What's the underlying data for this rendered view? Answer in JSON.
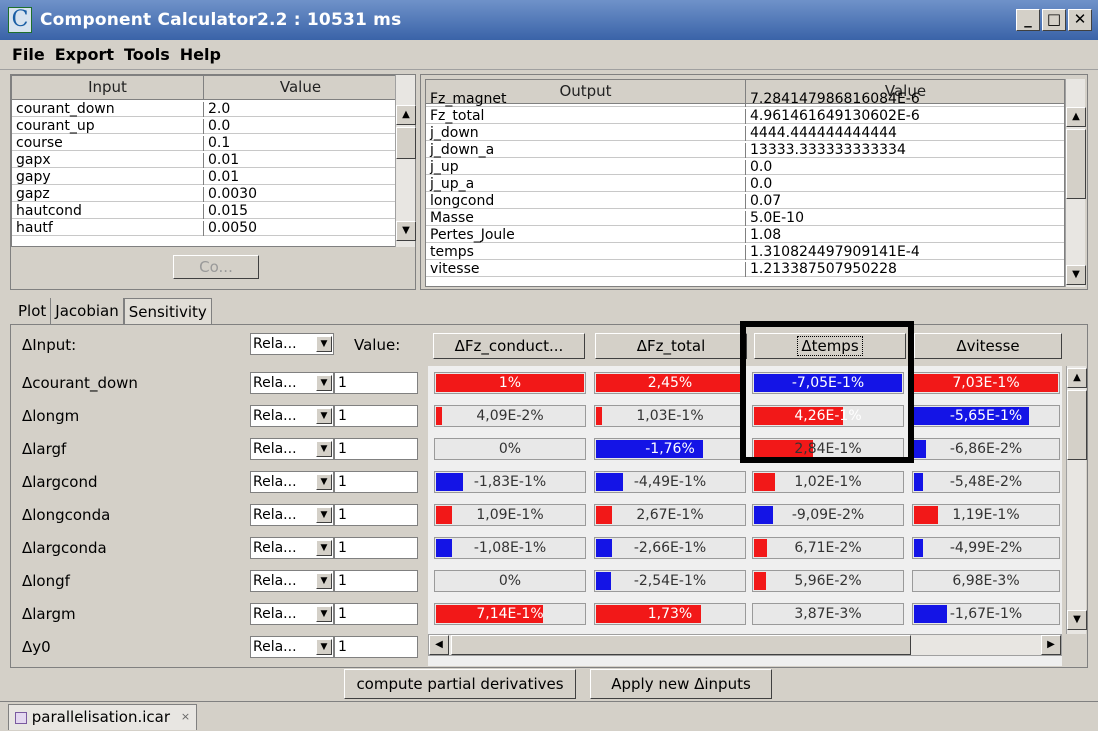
{
  "window": {
    "title": "Component Calculator2.2 : 10531 ms"
  },
  "menu": [
    "File",
    "Export",
    "Tools",
    "Help"
  ],
  "input_table": {
    "headers": [
      "Input",
      "Value"
    ],
    "rows": [
      [
        "courant_down",
        "2.0"
      ],
      [
        "courant_up",
        "0.0"
      ],
      [
        "course",
        "0.1"
      ],
      [
        "gapx",
        "0.01"
      ],
      [
        "gapy",
        "0.01"
      ],
      [
        "gapz",
        "0.0030"
      ],
      [
        "hautcond",
        "0.015"
      ],
      [
        "hautf",
        "0.0050"
      ]
    ],
    "button": "Co..."
  },
  "output_table": {
    "headers": [
      "Output",
      "Value"
    ],
    "rows": [
      [
        "Fz_magnet",
        "7.284147986816084E-6"
      ],
      [
        "Fz_total",
        "4.961461649130602E-6"
      ],
      [
        "j_down",
        "4444.444444444444"
      ],
      [
        "j_down_a",
        "13333.333333333334"
      ],
      [
        "j_up",
        "0.0"
      ],
      [
        "j_up_a",
        "0.0"
      ],
      [
        "longcond",
        "0.07"
      ],
      [
        "Masse",
        "5.0E-10"
      ],
      [
        "Pertes_Joule",
        "1.08"
      ],
      [
        "temps",
        "1.310824497909141E-4"
      ],
      [
        "vitesse",
        "1.213387507950228"
      ]
    ]
  },
  "tabs": [
    "Plot",
    "Jacobian",
    "Sensitivity"
  ],
  "sensitivity": {
    "input_label": "ΔInput:",
    "header_combo": "Rela...",
    "value_label": "Value:",
    "columns": [
      "ΔFz_conduct...",
      "ΔFz_total",
      "Δtemps",
      "Δvitesse"
    ],
    "rows": [
      {
        "name": "Δcourant_down",
        "mode": "Rela...",
        "value": "1"
      },
      {
        "name": "Δlongm",
        "mode": "Rela...",
        "value": "1"
      },
      {
        "name": "Δlargf",
        "mode": "Rela...",
        "value": "1"
      },
      {
        "name": "Δlargcond",
        "mode": "Rela...",
        "value": "1"
      },
      {
        "name": "Δlongconda",
        "mode": "Rela...",
        "value": "1"
      },
      {
        "name": "Δlargconda",
        "mode": "Rela...",
        "value": "1"
      },
      {
        "name": "Δlongf",
        "mode": "Rela...",
        "value": "1"
      },
      {
        "name": "Δlargm",
        "mode": "Rela...",
        "value": "1"
      },
      {
        "name": "Δy0",
        "mode": "Rela...",
        "value": "1"
      }
    ],
    "cells": [
      [
        {
          "t": "1%",
          "f": 1.0,
          "c": "red"
        },
        {
          "t": "2,45%",
          "f": 1.0,
          "c": "red"
        },
        {
          "t": "-7,05E-1%",
          "f": 1.0,
          "c": "blue"
        },
        {
          "t": "7,03E-1%",
          "f": 1.0,
          "c": "red"
        }
      ],
      [
        {
          "t": "4,09E-2%",
          "f": 0.03,
          "c": "red"
        },
        {
          "t": "1,03E-1%",
          "f": 0.04,
          "c": "red"
        },
        {
          "t": "4,26E-1%",
          "f": 0.6,
          "c": "red"
        },
        {
          "t": "-5,65E-1%",
          "f": 0.8,
          "c": "blue"
        }
      ],
      [
        {
          "t": "0%",
          "f": 0,
          "c": "red"
        },
        {
          "t": "-1,76%",
          "f": 0.72,
          "c": "blue"
        },
        {
          "t": "2,84E-1%",
          "f": 0.4,
          "c": "red"
        },
        {
          "t": "-6,86E-2%",
          "f": 0.08,
          "c": "blue"
        }
      ],
      [
        {
          "t": "-1,83E-1%",
          "f": 0.18,
          "c": "blue"
        },
        {
          "t": "-4,49E-1%",
          "f": 0.18,
          "c": "blue"
        },
        {
          "t": "1,02E-1%",
          "f": 0.14,
          "c": "red"
        },
        {
          "t": "-5,48E-2%",
          "f": 0.06,
          "c": "blue"
        }
      ],
      [
        {
          "t": "1,09E-1%",
          "f": 0.11,
          "c": "red"
        },
        {
          "t": "2,67E-1%",
          "f": 0.11,
          "c": "red"
        },
        {
          "t": "-9,09E-2%",
          "f": 0.13,
          "c": "blue"
        },
        {
          "t": "1,19E-1%",
          "f": 0.17,
          "c": "red"
        }
      ],
      [
        {
          "t": "-1,08E-1%",
          "f": 0.11,
          "c": "blue"
        },
        {
          "t": "-2,66E-1%",
          "f": 0.11,
          "c": "blue"
        },
        {
          "t": "6,71E-2%",
          "f": 0.09,
          "c": "red"
        },
        {
          "t": "-4,99E-2%",
          "f": 0.06,
          "c": "blue"
        }
      ],
      [
        {
          "t": "0%",
          "f": 0,
          "c": "red"
        },
        {
          "t": "-2,54E-1%",
          "f": 0.1,
          "c": "blue"
        },
        {
          "t": "5,96E-2%",
          "f": 0.08,
          "c": "red"
        },
        {
          "t": "6,98E-3%",
          "f": 0,
          "c": "red"
        }
      ],
      [
        {
          "t": "7,14E-1%",
          "f": 0.72,
          "c": "red"
        },
        {
          "t": "1,73%",
          "f": 0.71,
          "c": "red"
        },
        {
          "t": "3,87E-3%",
          "f": 0,
          "c": "red"
        },
        {
          "t": "-1,67E-1%",
          "f": 0.23,
          "c": "blue"
        }
      ]
    ],
    "buttons": [
      "compute partial derivatives",
      "Apply new Δinputs"
    ]
  },
  "colors": {
    "red": "#f21818",
    "blue": "#1414e6"
  },
  "status": {
    "file_tab": "parallelisation.icar",
    "close": "×"
  }
}
